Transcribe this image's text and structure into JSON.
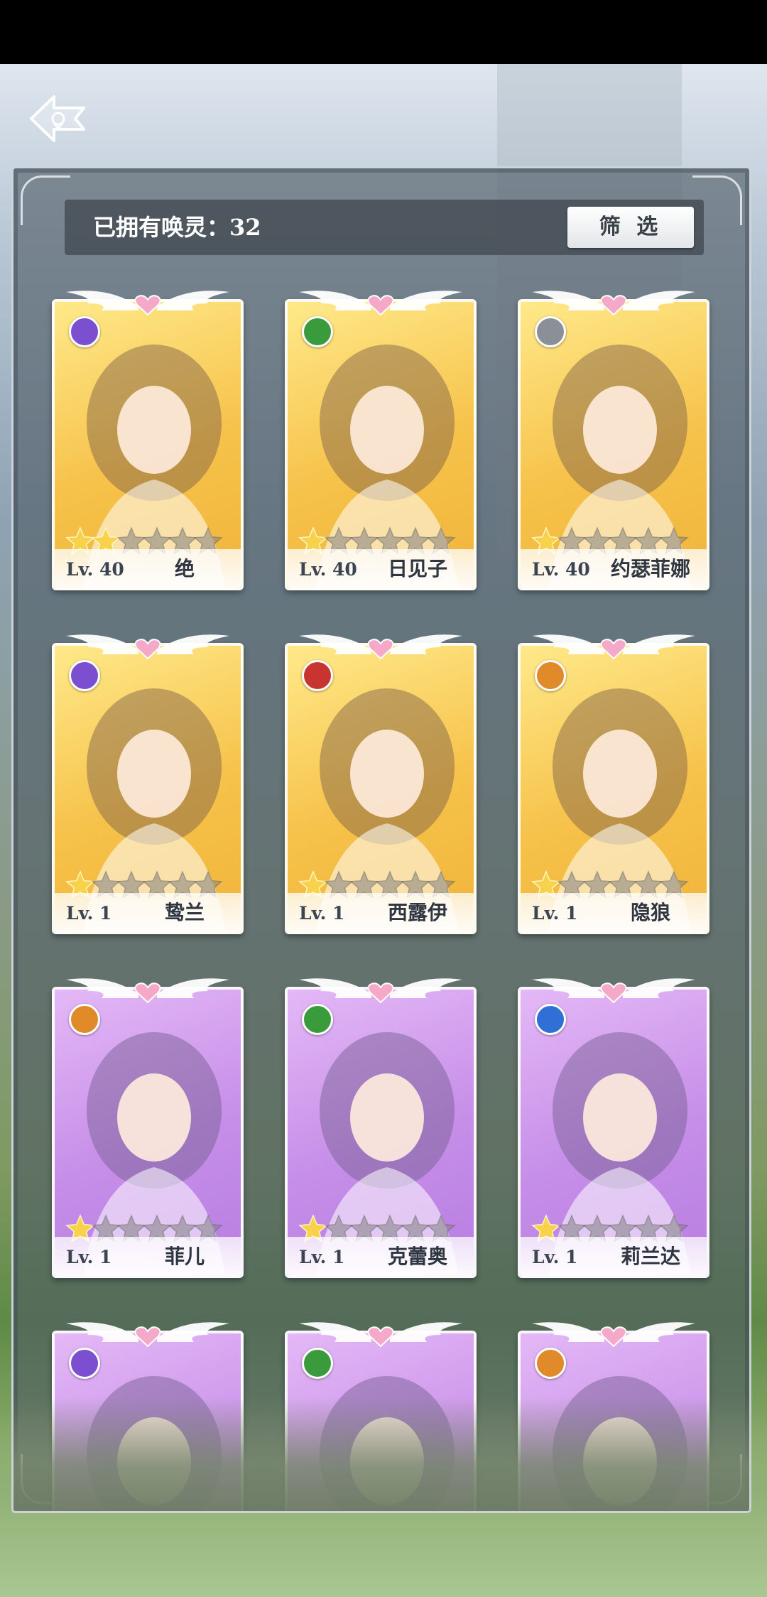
{
  "header": {
    "owned_label": "已拥有唤灵：32",
    "filter_label": "筛 选"
  },
  "cards": [
    {
      "level": "Lv. 40",
      "name": "绝",
      "rarity": "gold",
      "element_color": "#7b4fd0",
      "element": "purple-swirl-icon",
      "stars_filled": 2,
      "stars_total": 6
    },
    {
      "level": "Lv. 40",
      "name": "日见子",
      "rarity": "gold",
      "element_color": "#3a9b3c",
      "element": "green-wind-icon",
      "stars_filled": 1,
      "stars_total": 6
    },
    {
      "level": "Lv. 40",
      "name": "约瑟菲娜",
      "rarity": "gold",
      "element_color": "#8a8f98",
      "element": "grey-circle-icon",
      "stars_filled": 1,
      "stars_total": 6
    },
    {
      "level": "Lv. 1",
      "name": "鸷兰",
      "rarity": "gold",
      "element_color": "#7b4fd0",
      "element": "purple-swirl-icon",
      "stars_filled": 1,
      "stars_total": 6
    },
    {
      "level": "Lv. 1",
      "name": "西露伊",
      "rarity": "gold",
      "element_color": "#c8342f",
      "element": "red-fire-icon",
      "stars_filled": 1,
      "stars_total": 6
    },
    {
      "level": "Lv. 1",
      "name": "隐狼",
      "rarity": "gold",
      "element_color": "#e08a2a",
      "element": "orange-square-icon",
      "stars_filled": 1,
      "stars_total": 6
    },
    {
      "level": "Lv. 1",
      "name": "菲儿",
      "rarity": "purple",
      "element_color": "#e08a2a",
      "element": "orange-square-icon",
      "stars_filled": 1,
      "stars_total": 6
    },
    {
      "level": "Lv. 1",
      "name": "克蕾奥",
      "rarity": "purple",
      "element_color": "#3a9b3c",
      "element": "green-wind-icon",
      "stars_filled": 1,
      "stars_total": 6
    },
    {
      "level": "Lv. 1",
      "name": "莉兰达",
      "rarity": "purple",
      "element_color": "#2f6fd6",
      "element": "blue-drop-icon",
      "stars_filled": 1,
      "stars_total": 6
    },
    {
      "level": "",
      "name": "",
      "rarity": "purple",
      "element_color": "#7b4fd0",
      "element": "purple-swirl-icon",
      "stars_filled": 0,
      "stars_total": 0
    },
    {
      "level": "",
      "name": "",
      "rarity": "purple",
      "element_color": "#3a9b3c",
      "element": "green-wind-icon",
      "stars_filled": 0,
      "stars_total": 0
    },
    {
      "level": "",
      "name": "",
      "rarity": "purple",
      "element_color": "#e08a2a",
      "element": "orange-square-icon",
      "stars_filled": 0,
      "stars_total": 0
    }
  ]
}
